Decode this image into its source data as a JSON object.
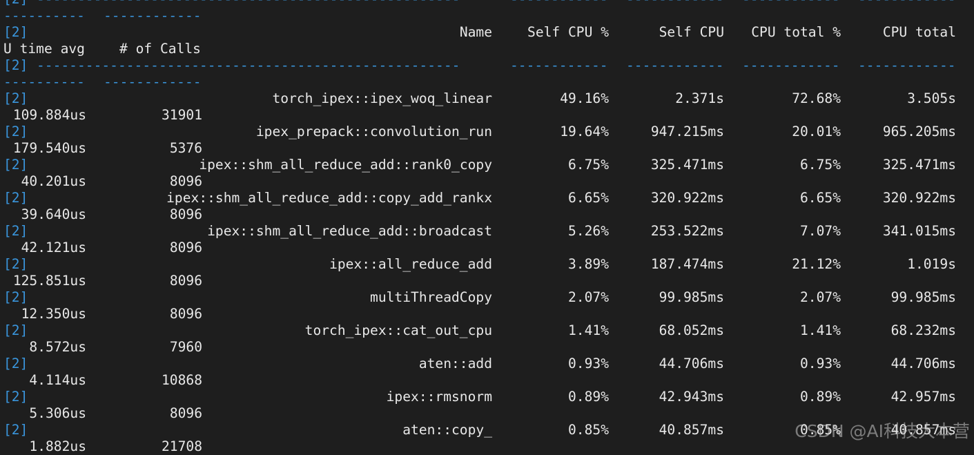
{
  "tag": "[2]",
  "separator": {
    "seg0": "----------------------------------------------------",
    "seg1": "------------",
    "wrap0": "----------",
    "wrap1": "------------"
  },
  "header": {
    "name": "Name",
    "self_cpu_pct": "Self CPU %",
    "self_cpu": "Self CPU",
    "cpu_total_pct": "CPU total %",
    "cpu_total": "CPU total",
    "wrap_time_avg": "U time avg",
    "wrap_calls": "# of Calls"
  },
  "rows": [
    {
      "name": "torch_ipex::ipex_woq_linear",
      "self_cpu_pct": "49.16%",
      "self_cpu": "2.371s",
      "cpu_total_pct": "72.68%",
      "cpu_total": "3.505s",
      "time_avg": "109.884us",
      "calls": "31901"
    },
    {
      "name": "ipex_prepack::convolution_run",
      "self_cpu_pct": "19.64%",
      "self_cpu": "947.215ms",
      "cpu_total_pct": "20.01%",
      "cpu_total": "965.205ms",
      "time_avg": "179.540us",
      "calls": "5376"
    },
    {
      "name": "ipex::shm_all_reduce_add::rank0_copy",
      "self_cpu_pct": "6.75%",
      "self_cpu": "325.471ms",
      "cpu_total_pct": "6.75%",
      "cpu_total": "325.471ms",
      "time_avg": "40.201us",
      "calls": "8096"
    },
    {
      "name": "ipex::shm_all_reduce_add::copy_add_rankx",
      "self_cpu_pct": "6.65%",
      "self_cpu": "320.922ms",
      "cpu_total_pct": "6.65%",
      "cpu_total": "320.922ms",
      "time_avg": "39.640us",
      "calls": "8096"
    },
    {
      "name": "ipex::shm_all_reduce_add::broadcast",
      "self_cpu_pct": "5.26%",
      "self_cpu": "253.522ms",
      "cpu_total_pct": "7.07%",
      "cpu_total": "341.015ms",
      "time_avg": "42.121us",
      "calls": "8096"
    },
    {
      "name": "ipex::all_reduce_add",
      "self_cpu_pct": "3.89%",
      "self_cpu": "187.474ms",
      "cpu_total_pct": "21.12%",
      "cpu_total": "1.019s",
      "time_avg": "125.851us",
      "calls": "8096"
    },
    {
      "name": "multiThreadCopy",
      "self_cpu_pct": "2.07%",
      "self_cpu": "99.985ms",
      "cpu_total_pct": "2.07%",
      "cpu_total": "99.985ms",
      "time_avg": "12.350us",
      "calls": "8096"
    },
    {
      "name": "torch_ipex::cat_out_cpu",
      "self_cpu_pct": "1.41%",
      "self_cpu": "68.052ms",
      "cpu_total_pct": "1.41%",
      "cpu_total": "68.232ms",
      "time_avg": "8.572us",
      "calls": "7960"
    },
    {
      "name": "aten::add",
      "self_cpu_pct": "0.93%",
      "self_cpu": "44.706ms",
      "cpu_total_pct": "0.93%",
      "cpu_total": "44.706ms",
      "time_avg": "4.114us",
      "calls": "10868"
    },
    {
      "name": "ipex::rmsnorm",
      "self_cpu_pct": "0.89%",
      "self_cpu": "42.943ms",
      "cpu_total_pct": "0.89%",
      "cpu_total": "42.957ms",
      "time_avg": "5.306us",
      "calls": "8096"
    },
    {
      "name": "aten::copy_",
      "self_cpu_pct": "0.85%",
      "self_cpu": "40.857ms",
      "cpu_total_pct": "0.85%",
      "cpu_total": "40.857ms",
      "time_avg": "1.882us",
      "calls": "21708"
    }
  ],
  "watermark": "CSDN @AI科技大本营",
  "colors": {
    "background": "#1e1e1e",
    "text": "#e8e8e8",
    "accent": "#3a96dd"
  }
}
